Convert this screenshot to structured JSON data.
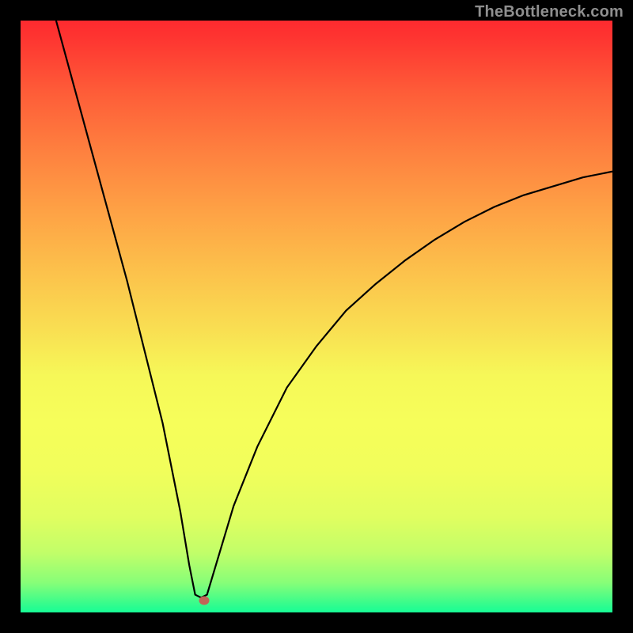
{
  "watermark": "TheBottleneck.com",
  "chart_data": {
    "type": "line",
    "title": "",
    "xlabel": "",
    "ylabel": "",
    "xlim": [
      0,
      100
    ],
    "ylim": [
      0,
      100
    ],
    "background_gradient": {
      "top_color": "#fe2a2f",
      "mid_color": "#f6f858",
      "bottom_color": "#17fe95"
    },
    "series": [
      {
        "name": "bottleneck-curve",
        "color": "#000000",
        "x": [
          6.0,
          9.0,
          12.0,
          15.0,
          18.0,
          21.0,
          24.0,
          27.0,
          28.5,
          29.5,
          30.5,
          31.5,
          33.0,
          36.0,
          40.0,
          45.0,
          50.0,
          55.0,
          60.0,
          65.0,
          70.0,
          75.0,
          80.0,
          85.0,
          90.0,
          95.0,
          100.0
        ],
        "y": [
          100.0,
          89.0,
          78.0,
          67.0,
          56.0,
          44.0,
          32.0,
          17.0,
          8.0,
          3.0,
          2.5,
          3.0,
          8.0,
          18.0,
          28.0,
          38.0,
          45.0,
          51.0,
          55.5,
          59.5,
          63.0,
          66.0,
          68.5,
          70.5,
          72.0,
          73.5,
          74.5
        ]
      }
    ],
    "marker": {
      "name": "current-point",
      "color": "#c16557",
      "x": 31.0,
      "y": 2.0
    }
  }
}
